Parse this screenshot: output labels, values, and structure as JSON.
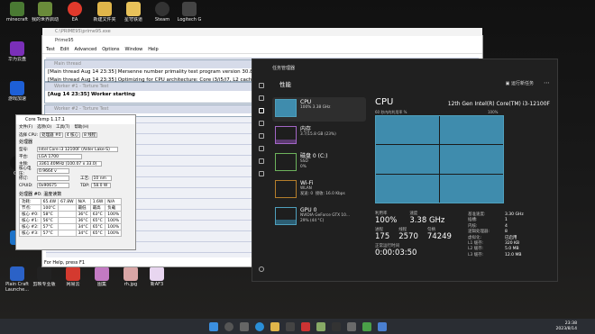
{
  "desktop": {
    "icons": [
      {
        "label": "minecraft",
        "color": "#4a7a33"
      },
      {
        "label": "我的世界启动",
        "color": "#6a8b3a"
      },
      {
        "label": "EA",
        "color": "#e03a2c"
      },
      {
        "label": "新建文件夹",
        "color": "#e0b54a"
      },
      {
        "label": "星穹铁道",
        "color": "#e8c25a"
      },
      {
        "label": "Steam",
        "color": "#333"
      },
      {
        "label": "Logitech G",
        "color": "#444"
      }
    ],
    "left_icons": [
      {
        "label": "华为云盘",
        "color": "#7a2fb8"
      },
      {
        "label": "游戏加速",
        "color": "#1d5fd6"
      },
      {
        "label": "",
        "color": "#333"
      },
      {
        "label": "QQ",
        "color": "#111"
      },
      {
        "label": "",
        "color": "#1d73c9"
      },
      {
        "label": "",
        "color": "#c33"
      }
    ],
    "bottom_icons": [
      {
        "label": "Plain Craft Launche...",
        "color": "#2b62c7"
      },
      {
        "label": "剪映专业版",
        "color": "#222"
      },
      {
        "label": "网易云",
        "color": "#d43a2f"
      },
      {
        "label": "图集",
        "color": "#c37ac3"
      },
      {
        "label": "rh.jpg",
        "color": "#d9a6a6"
      },
      {
        "label": "新AF3",
        "color": "#e8d6f0"
      }
    ]
  },
  "prime95": {
    "title": "Prime95",
    "path": "C:\\PRIME95\\prime95.exe",
    "menu": [
      "Test",
      "Edit",
      "Advanced",
      "Options",
      "Window",
      "Help"
    ],
    "main_line1": "[Main thread Aug 14 23:35] Mersenne number primality test program version 30.8",
    "main_line2": "[Main thread Aug 14 23:35] Optimizing for CPU architecture: Core i3/i5/i7, L2 cache size: 1.25 MB",
    "worker1_title": "Worker #1 - Torture Test",
    "worker1_line": "[Aug 14 23:35] Worker starting",
    "worker2_title": "Worker #2 - Torture Test",
    "status": "For Help, press F1"
  },
  "coretemp": {
    "title": "Core Temp 1.17.1",
    "menu": [
      "文件(F)",
      "选项(O)",
      "工具(T)",
      "帮助(H)"
    ],
    "select_cpu_label": "选择 CPU:",
    "processor_count": "处理器 #0",
    "cores_text": "4 核心",
    "threads_text": "8 线程",
    "info_group": "处理器",
    "model": "Intel Core i3 12100F (Alder Lake-S)",
    "platform": "LGA 1700",
    "frequency": "3361.40MHz (100.07 x 33.0)",
    "vid": "0.9664 v",
    "revision": "",
    "lithography": "10 nm",
    "cpuid": "0x90675",
    "tdp": "58.0 W",
    "readings_group": "处理器 #0: 温度读数",
    "power_row": [
      "功耗:",
      "65.4W",
      "67.8W",
      "N/A",
      "1.6W",
      "N/A"
    ],
    "tj_row": [
      "节点:",
      "100°C",
      "",
      "最低",
      "最高",
      "负载"
    ],
    "cores": [
      [
        "核心 #0:",
        "58°C",
        "36°C",
        "63°C",
        "100%"
      ],
      [
        "核心 #1:",
        "56°C",
        "36°C",
        "65°C",
        "100%"
      ],
      [
        "核心 #2:",
        "57°C",
        "34°C",
        "65°C",
        "100%"
      ],
      [
        "核心 #3:",
        "57°C",
        "34°C",
        "65°C",
        "100%"
      ]
    ]
  },
  "taskmgr": {
    "title": "任务管理器",
    "section": "性能",
    "run_task": "运行新任务",
    "items": [
      {
        "name": "CPU",
        "sub": "100%  3.38 GHz"
      },
      {
        "name": "内存",
        "sub": "3.7/15.8 GB (23%)"
      },
      {
        "name": "磁盘 0 (C:)",
        "sub": "SSD\n0%"
      },
      {
        "name": "Wi-Fi",
        "sub": "WLAN\n发送: 0  接收: 16.0 Kbps"
      },
      {
        "name": "GPU 0",
        "sub": "NVIDIA GeForce GTX 10...\n29% (44 °C)"
      }
    ],
    "cpu_heading": "CPU",
    "cpu_model": "12th Gen Intel(R) Core(TM) i3-12100F",
    "graph_label": "60 秒内的利用率 %",
    "graph_max": "100%",
    "util_label": "利用率",
    "util": "100%",
    "speed_label": "速度",
    "speed": "3.38 GHz",
    "proc_label": "进程",
    "proc": "175",
    "thread_label": "线程",
    "thread": "2570",
    "handle_label": "句柄",
    "handle": "74249",
    "uptime_label": "正常运行时间",
    "uptime": "0:00:03:50",
    "kv": [
      [
        "基准速度:",
        "3.30 GHz"
      ],
      [
        "插槽:",
        "1"
      ],
      [
        "内核:",
        "4"
      ],
      [
        "逻辑处理器:",
        "8"
      ],
      [
        "虚拟化:",
        "已启用"
      ],
      [
        "L1 缓存:",
        "320 KB"
      ],
      [
        "L2 缓存:",
        "5.0 MB"
      ],
      [
        "L3 缓存:",
        "12.0 MB"
      ]
    ]
  },
  "clock": {
    "time": "23:38",
    "date": "2023/8/14"
  }
}
